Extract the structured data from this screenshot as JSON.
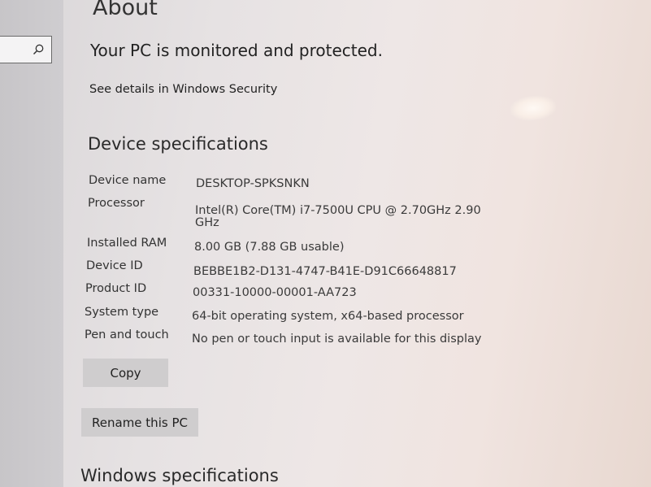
{
  "window": {
    "page_title": "About"
  },
  "search": {
    "value": ""
  },
  "security": {
    "status": "Your PC is monitored and protected.",
    "details_link": "See details in Windows Security"
  },
  "device_specs": {
    "heading": "Device specifications",
    "rows": [
      {
        "label": "Device name",
        "value": "DESKTOP-SPKSNKN",
        "value2": ""
      },
      {
        "label": "Processor",
        "value": "Intel(R) Core(TM) i7-7500U CPU @ 2.70GHz   2.90",
        "value2": "GHz"
      },
      {
        "label": "Installed RAM",
        "value": "8.00 GB (7.88 GB usable)",
        "value2": ""
      },
      {
        "label": "Device ID",
        "value": "BEBBE1B2-D131-4747-B41E-D91C66648817",
        "value2": ""
      },
      {
        "label": "Product ID",
        "value": "00331-10000-00001-AA723",
        "value2": ""
      },
      {
        "label": "System type",
        "value": "64-bit operating system, x64-based processor",
        "value2": ""
      },
      {
        "label": "Pen and touch",
        "value": "No pen or touch input is available for this display",
        "value2": ""
      }
    ],
    "copy_label": "Copy",
    "rename_label": "Rename this PC"
  },
  "windows_specs": {
    "heading": "Windows specifications"
  },
  "icons": {
    "search": "search-icon"
  }
}
